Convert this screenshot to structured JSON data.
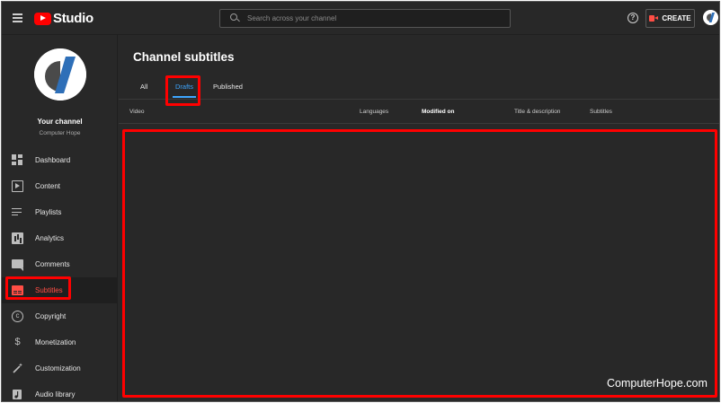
{
  "topbar": {
    "logo_text": "Studio",
    "search_placeholder": "Search across your channel",
    "help_symbol": "?",
    "create_label": "CREATE"
  },
  "sidebar": {
    "channel_name": "Your channel",
    "channel_handle": "Computer Hope",
    "items": [
      {
        "label": "Dashboard",
        "icon": "dashboard-icon"
      },
      {
        "label": "Content",
        "icon": "content-icon"
      },
      {
        "label": "Playlists",
        "icon": "playlists-icon"
      },
      {
        "label": "Analytics",
        "icon": "analytics-icon"
      },
      {
        "label": "Comments",
        "icon": "comments-icon"
      },
      {
        "label": "Subtitles",
        "icon": "subtitles-icon",
        "active": true
      },
      {
        "label": "Copyright",
        "icon": "copyright-icon"
      },
      {
        "label": "Monetization",
        "icon": "dollar-icon"
      },
      {
        "label": "Customization",
        "icon": "magic-wand-icon"
      },
      {
        "label": "Audio library",
        "icon": "audio-library-icon"
      }
    ]
  },
  "main": {
    "title": "Channel subtitles",
    "tabs": [
      {
        "label": "All"
      },
      {
        "label": "Drafts",
        "active": true
      },
      {
        "label": "Published"
      }
    ],
    "columns": {
      "video": "Video",
      "languages": "Languages",
      "modified_on": "Modified on",
      "title_description": "Title & description",
      "subtitles": "Subtitles"
    }
  },
  "watermark": "ComputerHope.com",
  "colors": {
    "background": "#282828",
    "accent_red": "#ff0000",
    "active_tab_blue": "#3ea6ff",
    "active_nav_red": "#ff4e45"
  }
}
